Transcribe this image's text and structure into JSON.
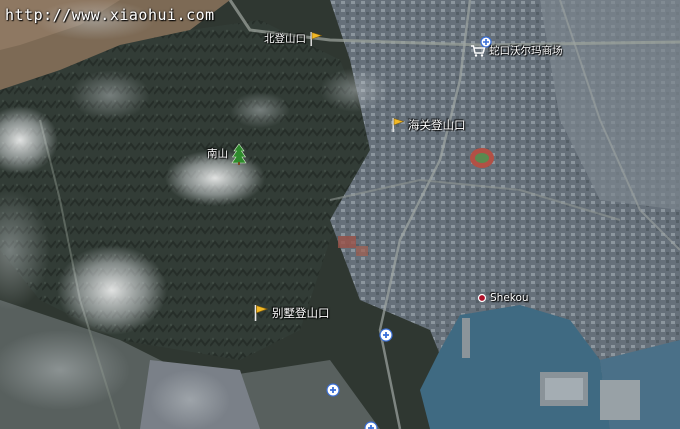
{
  "watermark": "http://www.xiaohui.com",
  "markers": {
    "north_trailhead": {
      "label": "北登山口",
      "icon": "flag-icon"
    },
    "walmart": {
      "label": "蛇口沃尔玛商场",
      "icon": "shopping-cart-icon"
    },
    "customs_trailhead": {
      "label": "海关登山口",
      "icon": "flag-icon"
    },
    "nanshan": {
      "label": "南山",
      "icon": "tree-icon"
    },
    "villa_trailhead": {
      "label": "别墅登山口",
      "icon": "flag-icon"
    },
    "shekou": {
      "label": "Shekou",
      "icon": "place-dot-icon"
    }
  },
  "colors": {
    "flag": "#f2b825",
    "water": "#3f6a82",
    "city": "#6b757c",
    "mountain": "#34403a"
  }
}
